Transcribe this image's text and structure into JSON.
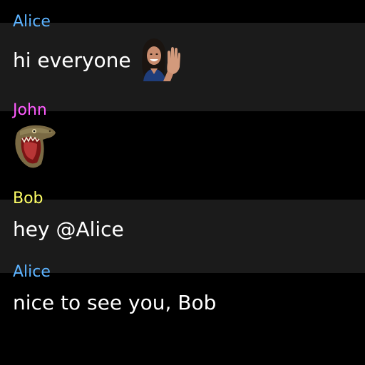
{
  "messages": [
    {
      "user": "Alice",
      "user_color": "#5cb3ff",
      "text": "hi everyone",
      "emote": "waving-woman-emote"
    },
    {
      "user": "John",
      "user_color": "#ff5cff",
      "text": "",
      "emote": "screaming-lizard-emote"
    },
    {
      "user": "Bob",
      "user_color": "#ffff66",
      "text": "hey @Alice"
    },
    {
      "user": "Alice",
      "user_color": "#5cb3ff",
      "text": "nice to see you, Bob"
    }
  ],
  "colors": {
    "background": "#000000",
    "alt_row": "#1b1b1b",
    "text": "#ffffff"
  }
}
